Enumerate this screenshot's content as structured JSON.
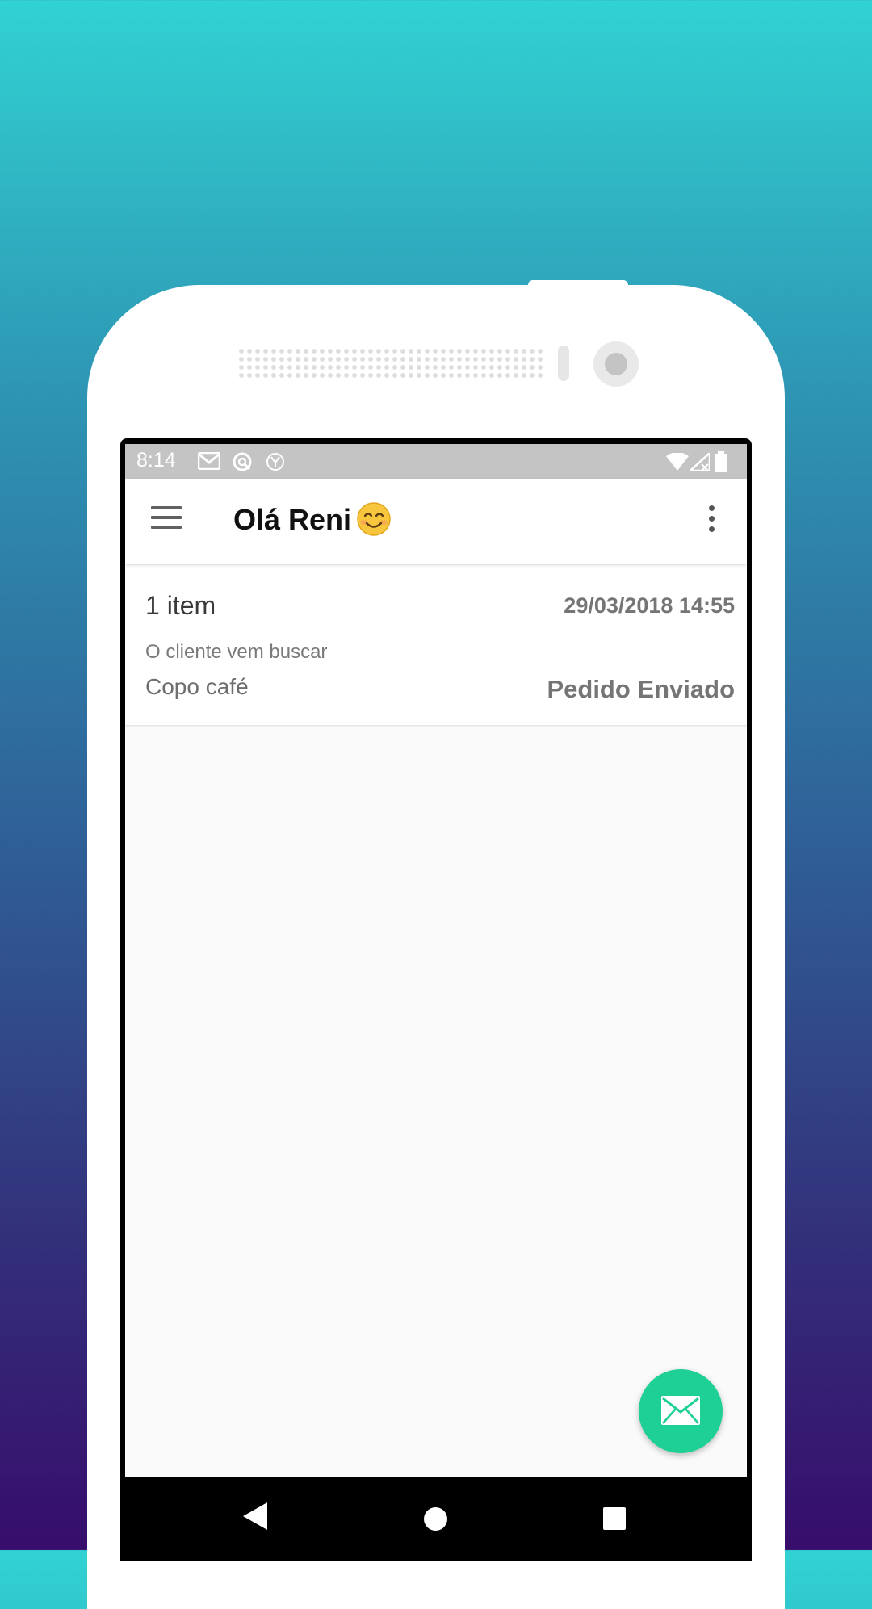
{
  "status_bar": {
    "time": "8:14",
    "notification_icons": [
      "gmail-icon",
      "sync-icon",
      "yandex-icon"
    ],
    "system_icons": [
      "wifi-icon",
      "signal-icon",
      "battery-icon"
    ]
  },
  "app_bar": {
    "title": "Olá Reni",
    "title_emoji": "smiling-face-icon",
    "menu_icon": "hamburger-menu-icon",
    "overflow_icon": "more-vert-icon"
  },
  "orders": [
    {
      "items_count": "1 item",
      "datetime": "29/03/2018 14:55",
      "delivery": "O cliente vem buscar",
      "product": "Copo café",
      "status": "Pedido Enviado"
    }
  ],
  "fab": {
    "icon": "envelope-icon",
    "color": "#1ecf96"
  },
  "nav_bar": {
    "icons": [
      "back-icon",
      "home-icon",
      "recents-icon"
    ]
  },
  "colors": {
    "background_top": "#31d2d2",
    "background_bottom": "#370d6c",
    "status_bar": "#c4c4c4",
    "accent": "#1ecf96"
  }
}
